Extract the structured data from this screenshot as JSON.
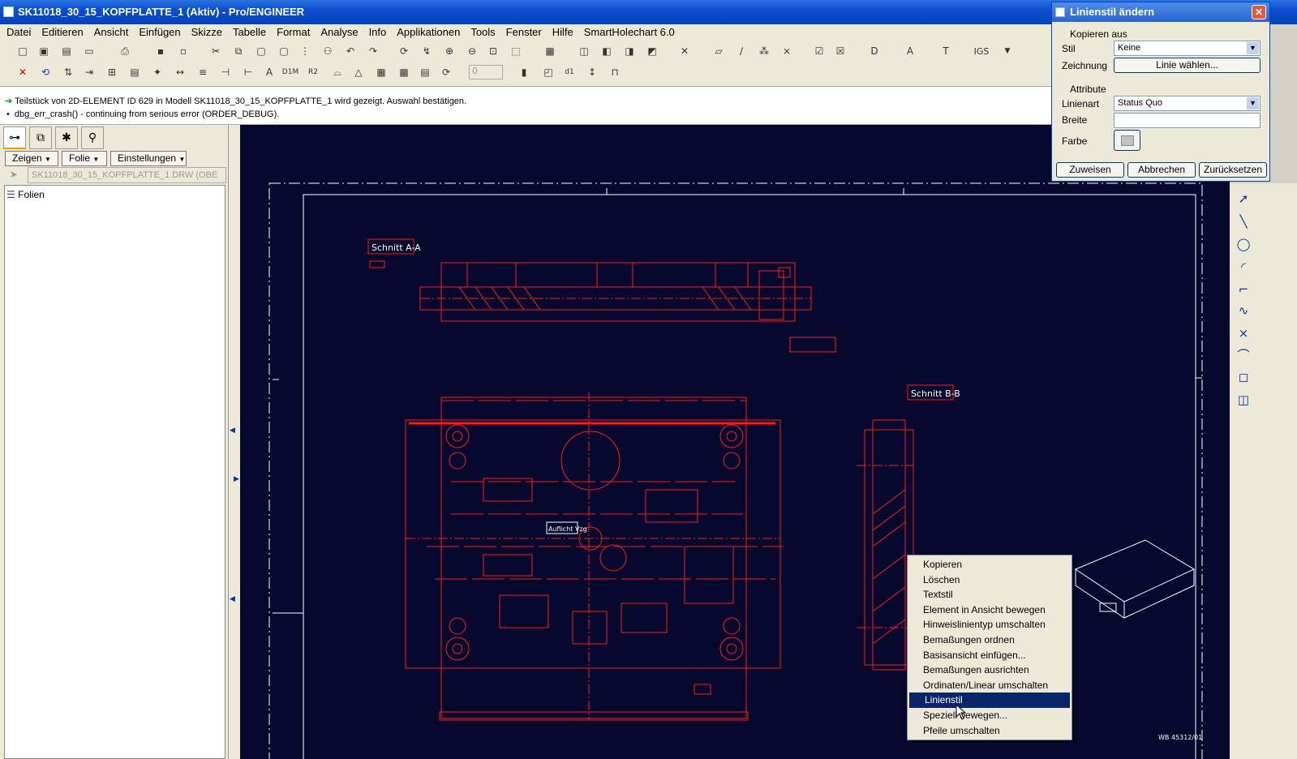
{
  "window": {
    "title": "SK11018_30_15_KOPFPLATTE_1 (Aktiv) - Pro/ENGINEER"
  },
  "menu": [
    "Datei",
    "Editieren",
    "Ansicht",
    "Einfügen",
    "Skizze",
    "Tabelle",
    "Format",
    "Analyse",
    "Info",
    "Applikationen",
    "Tools",
    "Fenster",
    "Hilfe",
    "SmartHolechart 6.0"
  ],
  "toolbar": {
    "igs_label": "IGS",
    "spin_value": "0"
  },
  "messages": {
    "line1": "Teilstück von 2D-ELEMENT ID 629 in Modell SK11018_30_15_KOPFPLATTE_1 wird gezeigt. Auswahl bestätigen.",
    "line2": "dbg_err_crash() - continuing from serious error (ORDER_DEBUG)."
  },
  "leftpanel": {
    "buttons": {
      "zeigen": "Zeigen",
      "folie": "Folie",
      "einstellungen": "Einstellungen"
    },
    "model_field": "SK11018_30_15_KOPFPLATTE_1.DRW (OBE",
    "tree_root": "Folien"
  },
  "drawing": {
    "section_a": "Schnitt A-A",
    "section_b": "Schnitt B-B",
    "detail_label": "Auflicht Vzg",
    "sheet_note": "WB 45312/01"
  },
  "dialog": {
    "title": "Linienstil ändern",
    "copy_from": "Kopieren aus",
    "stil_label": "Stil",
    "stil_value": "Keine",
    "zeichnung_label": "Zeichnung",
    "zeichnung_button": "Linie wählen...",
    "attribute": "Attribute",
    "linienart_label": "Linienart",
    "linienart_value": "Status Quo",
    "breite_label": "Breite",
    "breite_value": "",
    "farbe_label": "Farbe",
    "btn_assign": "Zuweisen",
    "btn_cancel": "Abbrechen",
    "btn_reset": "Zurücksetzen"
  },
  "context_menu": {
    "items": [
      "Kopieren",
      "Löschen",
      "Textstil",
      "Element in Ansicht bewegen",
      "Hinweislinientyp umschalten",
      "Bemaßungen ordnen",
      "Basisansicht einfügen...",
      "Bemaßungen ausrichten",
      "Ordinaten/Linear umschalten",
      "Linienstil",
      "Speziell bewegen...",
      "Pfeile umschalten"
    ],
    "selected_index": 9
  },
  "colors": {
    "canvas_bg": "#06082e",
    "drawing_red": "#ff1a1a",
    "frame_white": "#ffffff",
    "menu_highlight": "#0a246a"
  }
}
